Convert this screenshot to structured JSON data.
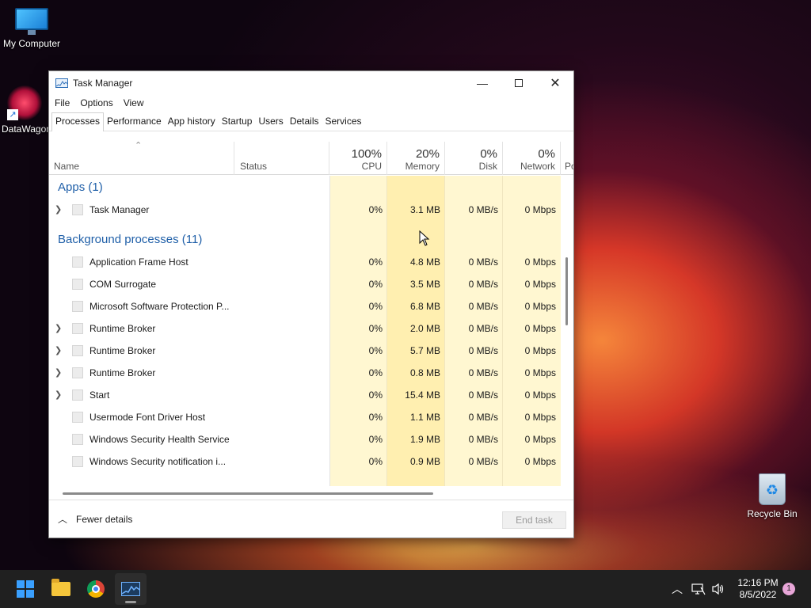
{
  "desktop": {
    "icons": [
      {
        "label": "My Computer"
      },
      {
        "label": "DataWagon"
      },
      {
        "label": "Recycle Bin"
      }
    ]
  },
  "window": {
    "title": "Task Manager",
    "menu": [
      "File",
      "Options",
      "View"
    ],
    "tabs": [
      "Processes",
      "Performance",
      "App history",
      "Startup",
      "Users",
      "Details",
      "Services"
    ],
    "active_tab": "Processes",
    "columns": {
      "name": "Name",
      "status": "Status",
      "cpu": {
        "label": "CPU",
        "total": "100%"
      },
      "memory": {
        "label": "Memory",
        "total": "20%"
      },
      "disk": {
        "label": "Disk",
        "total": "0%"
      },
      "network": {
        "label": "Network",
        "total": "0%"
      },
      "power": {
        "label": "Po"
      }
    },
    "groups": {
      "apps": "Apps (1)",
      "background": "Background processes (11)"
    },
    "apps": [
      {
        "name": "Task Manager",
        "cpu": "0%",
        "memory": "3.1 MB",
        "disk": "0 MB/s",
        "network": "0 Mbps",
        "expandable": true
      }
    ],
    "background": [
      {
        "name": "Application Frame Host",
        "cpu": "0%",
        "memory": "4.8 MB",
        "disk": "0 MB/s",
        "network": "0 Mbps",
        "expandable": false
      },
      {
        "name": "COM Surrogate",
        "cpu": "0%",
        "memory": "3.5 MB",
        "disk": "0 MB/s",
        "network": "0 Mbps",
        "expandable": false
      },
      {
        "name": "Microsoft Software Protection P...",
        "cpu": "0%",
        "memory": "6.8 MB",
        "disk": "0 MB/s",
        "network": "0 Mbps",
        "expandable": false
      },
      {
        "name": "Runtime Broker",
        "cpu": "0%",
        "memory": "2.0 MB",
        "disk": "0 MB/s",
        "network": "0 Mbps",
        "expandable": true
      },
      {
        "name": "Runtime Broker",
        "cpu": "0%",
        "memory": "5.7 MB",
        "disk": "0 MB/s",
        "network": "0 Mbps",
        "expandable": true
      },
      {
        "name": "Runtime Broker",
        "cpu": "0%",
        "memory": "0.8 MB",
        "disk": "0 MB/s",
        "network": "0 Mbps",
        "expandable": true
      },
      {
        "name": "Start",
        "cpu": "0%",
        "memory": "15.4 MB",
        "disk": "0 MB/s",
        "network": "0 Mbps",
        "expandable": true
      },
      {
        "name": "Usermode Font Driver Host",
        "cpu": "0%",
        "memory": "1.1 MB",
        "disk": "0 MB/s",
        "network": "0 Mbps",
        "expandable": false
      },
      {
        "name": "Windows Security Health Service",
        "cpu": "0%",
        "memory": "1.9 MB",
        "disk": "0 MB/s",
        "network": "0 Mbps",
        "expandable": false
      },
      {
        "name": "Windows Security notification i...",
        "cpu": "0%",
        "memory": "0.9 MB",
        "disk": "0 MB/s",
        "network": "0 Mbps",
        "expandable": false
      }
    ],
    "footer": {
      "fewer_details": "Fewer details",
      "end_task": "End task"
    },
    "colors": {
      "heat_light": "#fff8d6",
      "heat_mid": "#fff2bf",
      "heat_memory": "#ffeaa0",
      "group_title": "#1f5fa8"
    }
  },
  "taskbar": {
    "clock_time": "12:16 PM",
    "clock_date": "8/5/2022",
    "notification_count": "1",
    "tray_icons": [
      "chevron-up-icon",
      "network-icon",
      "speaker-icon"
    ]
  }
}
